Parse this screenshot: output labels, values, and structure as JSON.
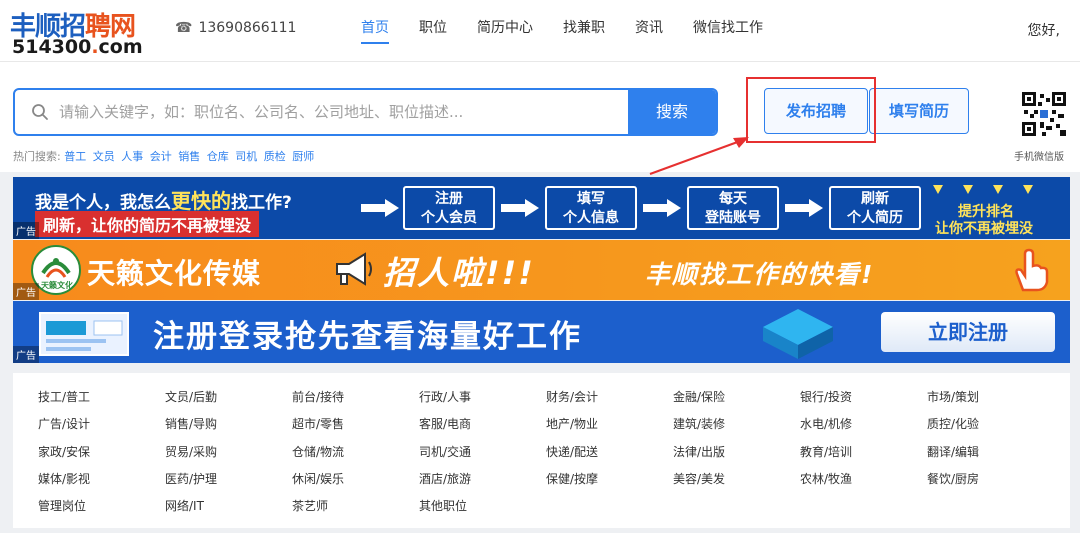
{
  "header": {
    "logo_top_a": "丰顺招",
    "logo_top_b": "聘网",
    "logo_num": "514300",
    "logo_dot": ".",
    "logo_com": "com",
    "phone": "13690866111",
    "nav": [
      "首页",
      "职位",
      "简历中心",
      "找兼职",
      "资讯",
      "微信找工作"
    ],
    "greeting": "您好,"
  },
  "search": {
    "placeholder": "请输入关键字，如：职位名、公司名、公司地址、职位描述...",
    "button": "搜索",
    "hot_label": "热门搜索:",
    "hot_terms": [
      "普工",
      "文员",
      "人事",
      "会计",
      "销售",
      "仓库",
      "司机",
      "质检",
      "厨师"
    ],
    "post_job": "发布招聘",
    "fill_resume": "填写简历",
    "qr_label": "手机微信版"
  },
  "banners": {
    "ad_tag": "广告",
    "b1": {
      "line1_a": "我是个人，我怎么",
      "line1_hl": "更快的",
      "line1_b": "找工作?",
      "line2": "刷新，让你的简历不再被埋没",
      "steps": [
        [
          "注册",
          "个人会员"
        ],
        [
          "填写",
          "个人信息"
        ],
        [
          "每天",
          "登陆账号"
        ],
        [
          "刷新",
          "个人简历"
        ]
      ],
      "tip1": "提升排名",
      "tip2": "让你不再被埋没"
    },
    "b2": {
      "logo_text": "天籁文化",
      "company": "天籁文化传媒",
      "slogan": "招人啦!!!",
      "sub": "丰顺找工作的快看!"
    },
    "b3": {
      "text": "注册登录抢先查看海量好工作",
      "button": "立即注册"
    }
  },
  "categories": [
    "技工/普工",
    "文员/后勤",
    "前台/接待",
    "行政/人事",
    "财务/会计",
    "金融/保险",
    "银行/投资",
    "市场/策划",
    "广告/设计",
    "销售/导购",
    "超市/零售",
    "客服/电商",
    "地产/物业",
    "建筑/装修",
    "水电/机修",
    "质控/化验",
    "家政/安保",
    "贸易/采购",
    "仓储/物流",
    "司机/交通",
    "快递/配送",
    "法律/出版",
    "教育/培训",
    "翻译/编辑",
    "媒体/影视",
    "医药/护理",
    "休闲/娱乐",
    "酒店/旅游",
    "保健/按摩",
    "美容/美发",
    "农林/牧渔",
    "餐饮/厨房",
    "管理岗位",
    "网络/IT",
    "茶艺师",
    "其他职位"
  ],
  "colors": {
    "primary": "#2f80ed",
    "highlight_frame": "#e63030",
    "banner_blue": "#0c4aa8",
    "banner_orange": "#f78a1c"
  }
}
